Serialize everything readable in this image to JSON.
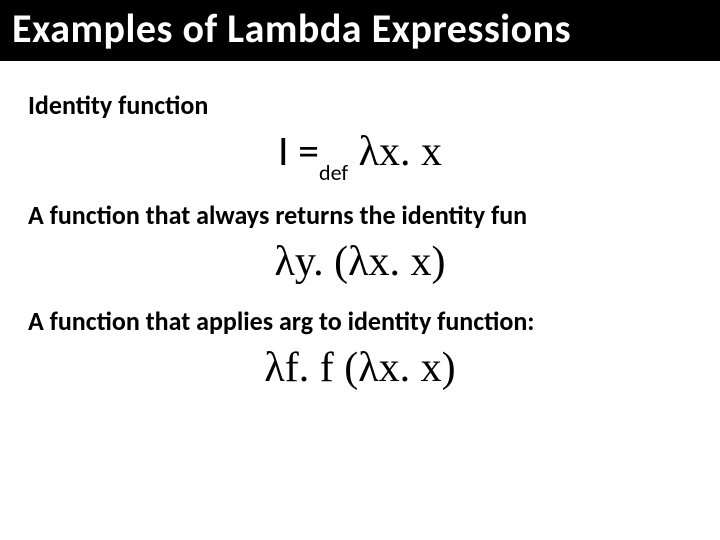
{
  "title": "Examples of Lambda Expressions",
  "sections": [
    {
      "desc": "Identity function",
      "expr_prefix": "I =",
      "expr_sub": "def",
      "expr_main": " λx. x"
    },
    {
      "desc": "A function that always returns the identity fun",
      "expr_prefix": "",
      "expr_sub": "",
      "expr_main": "λy. (λx. x)"
    },
    {
      "desc": "A function that applies arg to identity function:",
      "expr_prefix": "",
      "expr_sub": "",
      "expr_main": "λf. f (λx. x)"
    }
  ]
}
